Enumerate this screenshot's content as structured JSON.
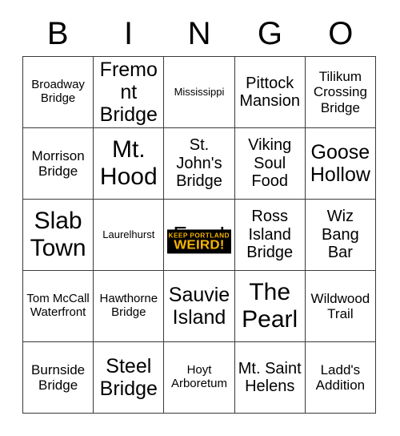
{
  "card": {
    "title": "BINGO",
    "headers": [
      "B",
      "I",
      "N",
      "G",
      "O"
    ],
    "grid_colors": {
      "border": "#3a3a3a",
      "background": "#ffffff",
      "text": "#000000"
    },
    "rows": [
      [
        {
          "label": "Broadway Bridge",
          "size": "s"
        },
        {
          "label": "Fremont Bridge",
          "size": "xl"
        },
        {
          "label": "Mississippi",
          "size": "xs"
        },
        {
          "label": "Pittock Mansion",
          "size": "l"
        },
        {
          "label": "Tilikum Crossing Bridge",
          "size": "m"
        }
      ],
      [
        {
          "label": "Morrison Bridge",
          "size": "m"
        },
        {
          "label": "Mt. Hood",
          "size": "xxl"
        },
        {
          "label": "St. John's Bridge",
          "size": "l"
        },
        {
          "label": "Viking Soul Food",
          "size": "l"
        },
        {
          "label": "Goose Hollow",
          "size": "xl"
        }
      ],
      [
        {
          "label": "Slab Town",
          "size": "xxl"
        },
        {
          "label": "Laurelhurst",
          "size": "xs"
        },
        {
          "label": "Free!",
          "size": "free",
          "sticker": {
            "line1": "KEEP PORTLAND",
            "line2": "WEIRD!",
            "background": "#000000",
            "text_color": "#f5b400"
          }
        },
        {
          "label": "Ross Island Bridge",
          "size": "l"
        },
        {
          "label": "Wiz Bang Bar",
          "size": "l"
        }
      ],
      [
        {
          "label": "Tom McCall Waterfront",
          "size": "s"
        },
        {
          "label": "Hawthorne Bridge",
          "size": "s"
        },
        {
          "label": "Sauvie Island",
          "size": "xl"
        },
        {
          "label": "The Pearl",
          "size": "xxl"
        },
        {
          "label": "Wildwood Trail",
          "size": "m"
        }
      ],
      [
        {
          "label": "Burnside Bridge",
          "size": "m"
        },
        {
          "label": "Steel Bridge",
          "size": "xl"
        },
        {
          "label": "Hoyt Arboretum",
          "size": "s"
        },
        {
          "label": "Mt. Saint Helens",
          "size": "l"
        },
        {
          "label": "Ladd's Addition",
          "size": "m"
        }
      ]
    ]
  }
}
